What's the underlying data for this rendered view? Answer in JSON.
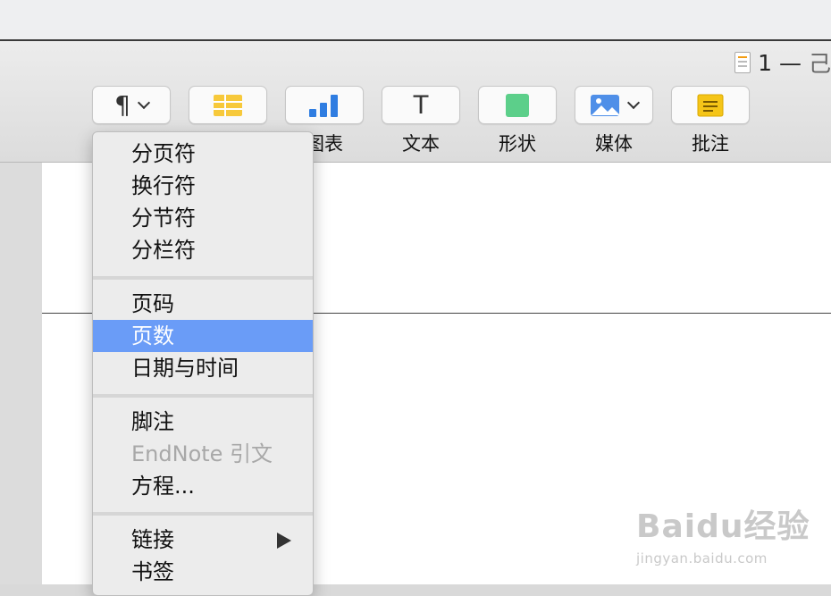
{
  "window": {
    "doc_title": "1 — ",
    "doc_title_trailing": "己"
  },
  "toolbar": {
    "items": [
      {
        "id": "insert",
        "label": "",
        "icon": "paragraph-icon",
        "glyph": "¶",
        "has_menu": true
      },
      {
        "id": "table",
        "label": "",
        "icon": "table-icon"
      },
      {
        "id": "chart",
        "label": "图表",
        "icon": "chart-icon"
      },
      {
        "id": "text",
        "label": "文本",
        "icon": "text-icon",
        "glyph": "T"
      },
      {
        "id": "shape",
        "label": "形状",
        "icon": "shape-icon"
      },
      {
        "id": "media",
        "label": "媒体",
        "icon": "media-icon",
        "has_menu": true
      },
      {
        "id": "comment",
        "label": "批注",
        "icon": "comment-icon"
      }
    ]
  },
  "insert_menu": {
    "groups": [
      {
        "items": [
          {
            "label": "分页符"
          },
          {
            "label": "换行符"
          },
          {
            "label": "分节符"
          },
          {
            "label": "分栏符"
          }
        ]
      },
      {
        "items": [
          {
            "label": "页码"
          },
          {
            "label": "页数",
            "selected": true
          },
          {
            "label": "日期与时间"
          }
        ]
      },
      {
        "items": [
          {
            "label": "脚注"
          },
          {
            "label": "EndNote 引文",
            "disabled": true
          },
          {
            "label": "方程..."
          }
        ]
      },
      {
        "items": [
          {
            "label": "链接",
            "submenu": true
          },
          {
            "label": "书签"
          }
        ]
      }
    ]
  },
  "watermark": {
    "main": "Baidu经验",
    "sub": "jingyan.baidu.com"
  },
  "colors": {
    "selection": "#6a9cf7",
    "table_icon": "#f7c93b",
    "chart_icon": "#2f7de1",
    "shape_icon": "#5ccf8a",
    "comment_icon": "#f5c518"
  }
}
